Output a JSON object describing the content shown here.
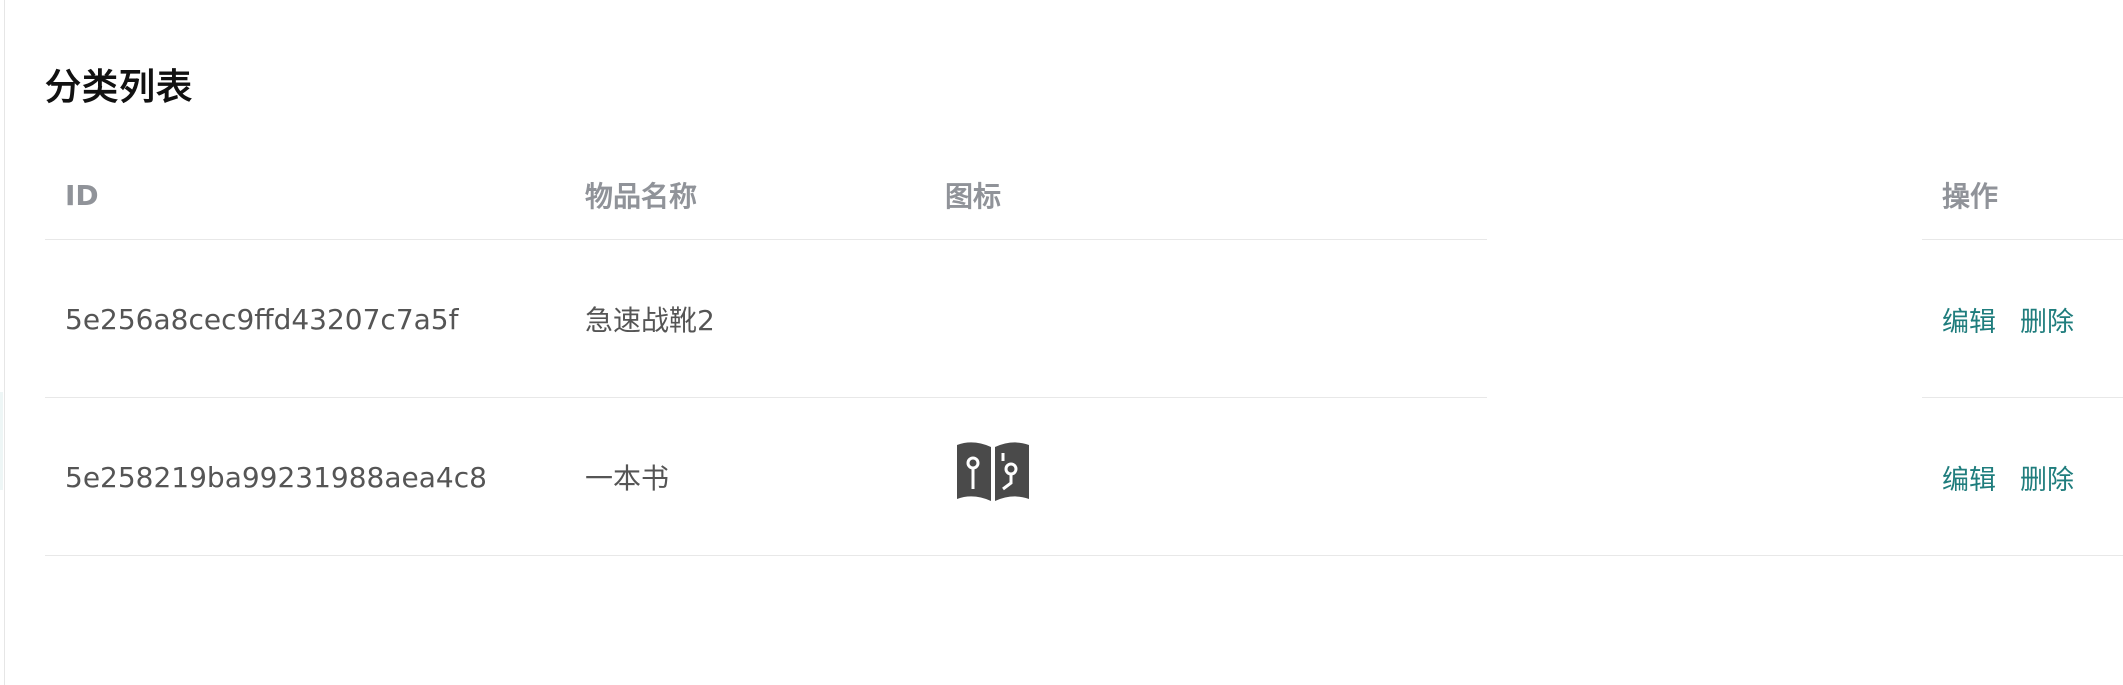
{
  "page": {
    "title": "分类列表"
  },
  "table": {
    "headers": {
      "id": "ID",
      "name": "物品名称",
      "icon": "图标",
      "ops": "操作"
    },
    "rows": [
      {
        "id": "5e256a8cec9ffd43207c7a5f",
        "name": "急速战靴2",
        "icon": "",
        "edit": "编辑",
        "delete": "删除"
      },
      {
        "id": "5e258219ba99231988aea4c8",
        "name": "一本书",
        "icon": "book-icon",
        "edit": "编辑",
        "delete": "删除"
      }
    ]
  },
  "colors": {
    "link": "#1f7d7d",
    "header_text": "#909399",
    "body_text": "#555555",
    "icon_fill": "#4a4a4a"
  }
}
